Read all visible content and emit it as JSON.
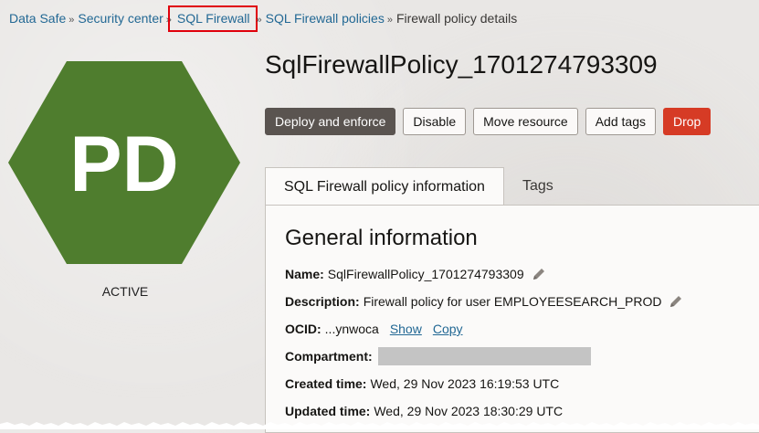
{
  "breadcrumb": {
    "items": [
      "Data Safe",
      "Security center",
      "SQL Firewall",
      "SQL Firewall policies"
    ],
    "current": "Firewall policy details",
    "separator": "»"
  },
  "policy": {
    "initials": "PD",
    "status": "ACTIVE",
    "title": "SqlFirewallPolicy_1701274793309",
    "icon_color": "#4f7d2e"
  },
  "actions": {
    "deploy": "Deploy and enforce",
    "disable": "Disable",
    "move": "Move resource",
    "add_tags": "Add tags",
    "drop": "Drop"
  },
  "tabs": [
    "SQL Firewall policy information",
    "Tags"
  ],
  "general": {
    "title": "General information",
    "name_label": "Name:",
    "name_value": "SqlFirewallPolicy_1701274793309",
    "description_label": "Description:",
    "description_value": "Firewall policy for user EMPLOYEESEARCH_PROD",
    "ocid_label": "OCID:",
    "ocid_value": "...ynwoca",
    "ocid_show": "Show",
    "ocid_copy": "Copy",
    "compartment_label": "Compartment:",
    "created_label": "Created time:",
    "created_value": "Wed, 29 Nov 2023 16:19:53 UTC",
    "updated_label": "Updated time:",
    "updated_value": "Wed, 29 Nov 2023 18:30:29 UTC"
  },
  "colors": {
    "link": "#226894",
    "primary_button": "#5a5450",
    "danger_button": "#d63b25",
    "highlight_box": "#e0000b"
  }
}
